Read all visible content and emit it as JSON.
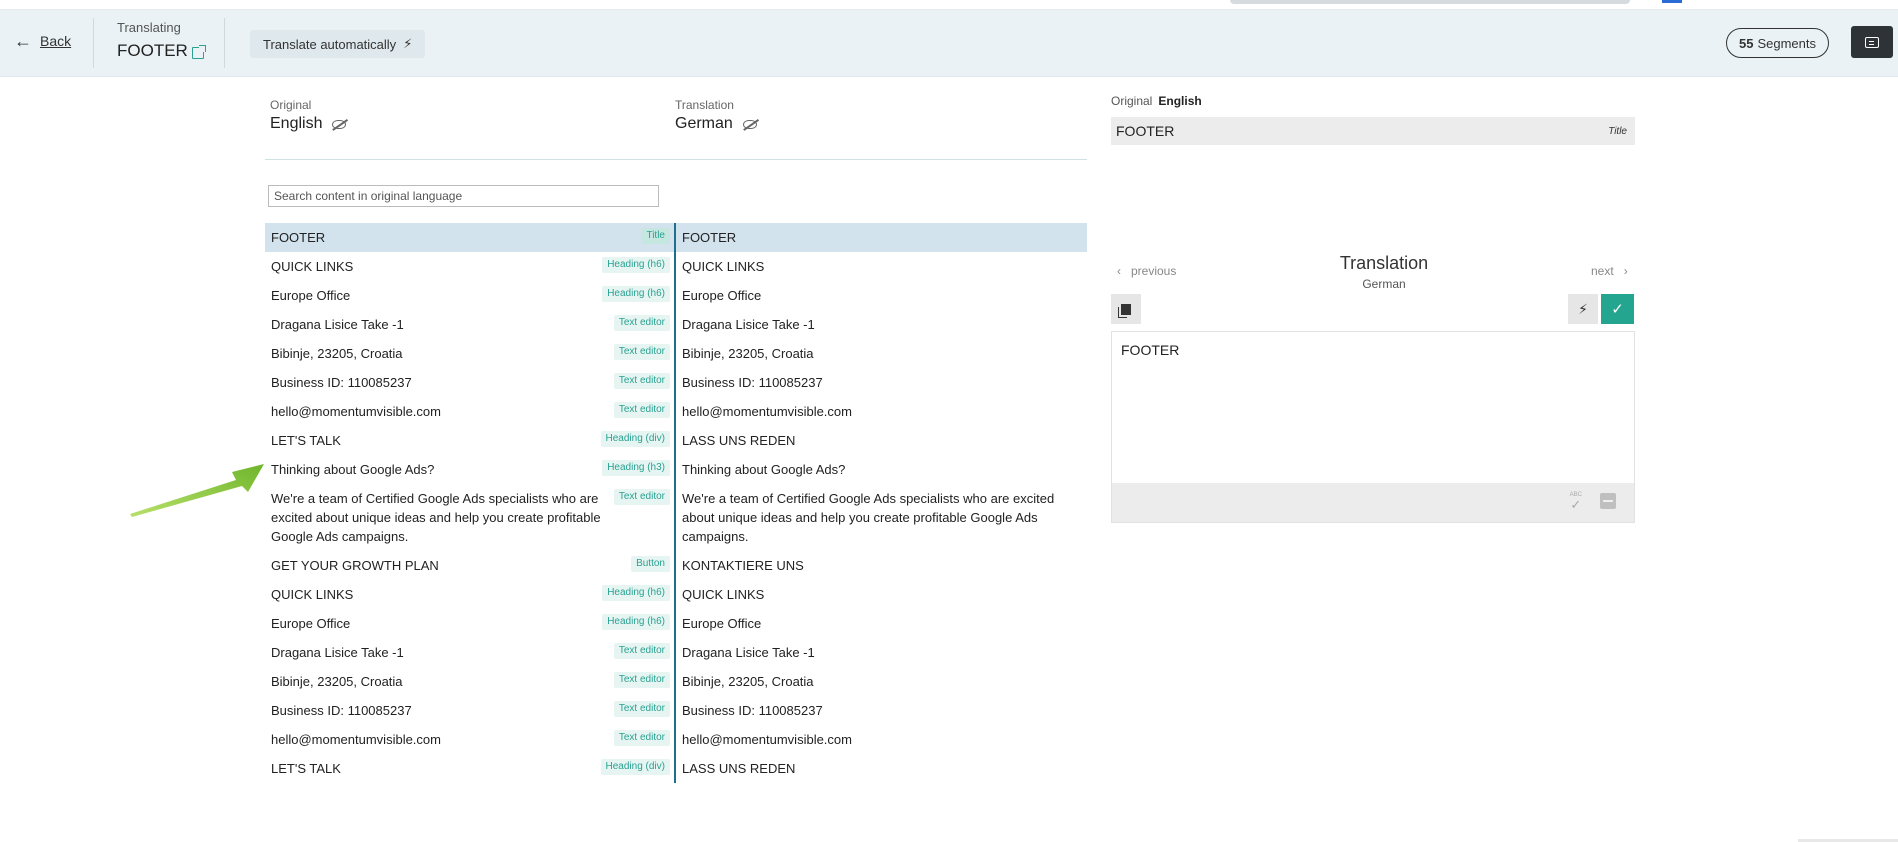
{
  "header": {
    "back_label": "Back",
    "translating_label": "Translating",
    "page_name": "FOOTER",
    "auto_translate_label": "Translate automatically",
    "segments_count": "55",
    "segments_label": "Segments"
  },
  "languages": {
    "original_label": "Original",
    "original_lang": "English",
    "translation_label": "Translation",
    "translation_lang": "German"
  },
  "search": {
    "placeholder": "Search content in original language"
  },
  "segments": [
    {
      "original": "FOOTER",
      "type": "Title",
      "translation": "FOOTER",
      "active": true
    },
    {
      "original": "QUICK LINKS",
      "type": "Heading (h6)",
      "translation": "QUICK LINKS"
    },
    {
      "original": "Europe Office",
      "type": "Heading (h6)",
      "translation": "Europe Office"
    },
    {
      "original": "Dragana Lisice Take -1",
      "type": "Text editor",
      "translation": "Dragana Lisice Take -1"
    },
    {
      "original": "Bibinje, 23205, Croatia",
      "type": "Text editor",
      "translation": "Bibinje, 23205, Croatia"
    },
    {
      "original": "Business ID: 110085237",
      "type": "Text editor",
      "translation": "Business ID: 110085237"
    },
    {
      "original": "hello@momentumvisible.com",
      "type": "Text editor",
      "translation": "hello@momentumvisible.com"
    },
    {
      "original": "LET'S TALK",
      "type": "Heading (div)",
      "translation": "LASS UNS REDEN"
    },
    {
      "original": "Thinking about Google Ads?",
      "type": "Heading (h3)",
      "translation": "Thinking about Google Ads?"
    },
    {
      "original": "We're a team of Certified Google Ads specialists who are excited about unique ideas and help you create profitable Google Ads campaigns.",
      "type": "Text editor",
      "translation": "We're a team of Certified Google Ads specialists who are excited about unique ideas and help you create profitable Google Ads campaigns."
    },
    {
      "original": "GET YOUR GROWTH PLAN",
      "type": "Button",
      "translation": "KONTAKTIERE UNS"
    },
    {
      "original": "QUICK LINKS",
      "type": "Heading (h6)",
      "translation": "QUICK LINKS"
    },
    {
      "original": "Europe Office",
      "type": "Heading (h6)",
      "translation": "Europe Office"
    },
    {
      "original": "Dragana Lisice Take -1",
      "type": "Text editor",
      "translation": "Dragana Lisice Take -1"
    },
    {
      "original": "Bibinje, 23205, Croatia",
      "type": "Text editor",
      "translation": "Bibinje, 23205, Croatia"
    },
    {
      "original": "Business ID: 110085237",
      "type": "Text editor",
      "translation": "Business ID: 110085237"
    },
    {
      "original": "hello@momentumvisible.com",
      "type": "Text editor",
      "translation": "hello@momentumvisible.com"
    },
    {
      "original": "LET'S TALK",
      "type": "Heading (div)",
      "translation": "LASS UNS REDEN"
    }
  ],
  "editor_panel": {
    "original_label": "Original",
    "original_lang": "English",
    "original_text": "FOOTER",
    "original_type": "Title",
    "previous_label": "previous",
    "next_label": "next",
    "title": "Translation",
    "subtitle": "German",
    "translation_text": "FOOTER",
    "spell_label": "ABC"
  },
  "colors": {
    "accent": "#23a58f",
    "header_bg": "#eaf2f5",
    "active_row": "#d2e3ee",
    "divider": "#1e6f8a",
    "arrow": "#8cc63f"
  },
  "icons": [
    "back-arrow-icon",
    "external-link-icon",
    "bolt-icon",
    "eye-slash-icon",
    "chat-icon",
    "chevron-left-icon",
    "chevron-right-icon",
    "copy-icon",
    "check-icon",
    "spellcheck-icon",
    "image-icon"
  ]
}
